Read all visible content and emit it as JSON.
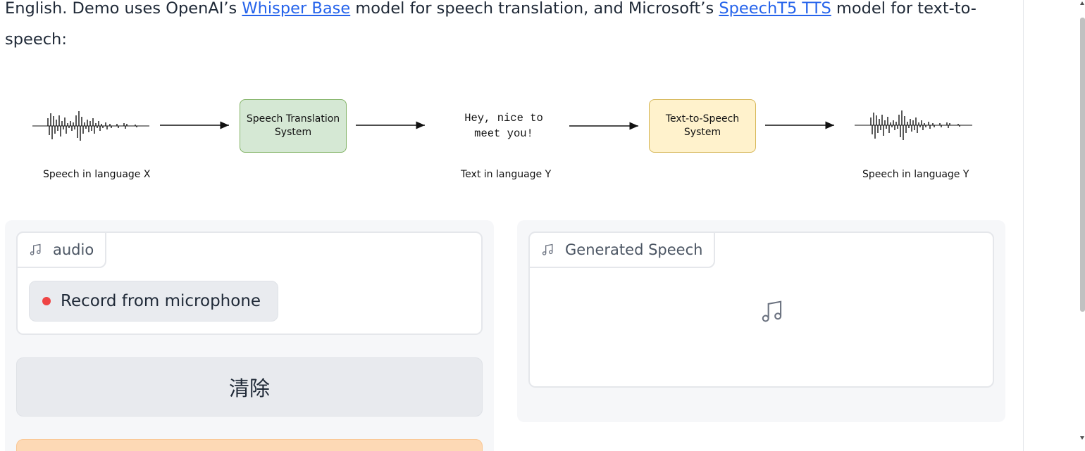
{
  "description": {
    "part1": "English. Demo uses OpenAI’s ",
    "link1": "Whisper Base",
    "part2": " model for speech translation, and Microsoft’s ",
    "link2": "SpeechT5 TTS",
    "part3": " model for text-to-speech:"
  },
  "diagram": {
    "caption_speech_x": "Speech in language X",
    "box_translation_line1": "Speech Translation",
    "box_translation_line2": "System",
    "text_sample_line1": "Hey, nice to",
    "text_sample_line2": "meet you!",
    "caption_text_y": "Text in language Y",
    "box_tts_line1": "Text-to-Speech",
    "box_tts_line2": "System",
    "caption_speech_y": "Speech in language Y",
    "colors": {
      "green_fill": "#d5e8d4",
      "green_border": "#82b366",
      "yellow_fill": "#fff2cc",
      "yellow_border": "#d6b656"
    }
  },
  "input_panel": {
    "label": "audio",
    "label_icon": "music-note-icon",
    "record_label": "Record from microphone",
    "clear_label": "清除",
    "colors": {
      "record_dot": "#ef4444",
      "submit_bg": "#fdd9b5"
    }
  },
  "output_panel": {
    "label": "Generated Speech",
    "label_icon": "music-note-icon",
    "empty_icon": "music-note-icon"
  }
}
